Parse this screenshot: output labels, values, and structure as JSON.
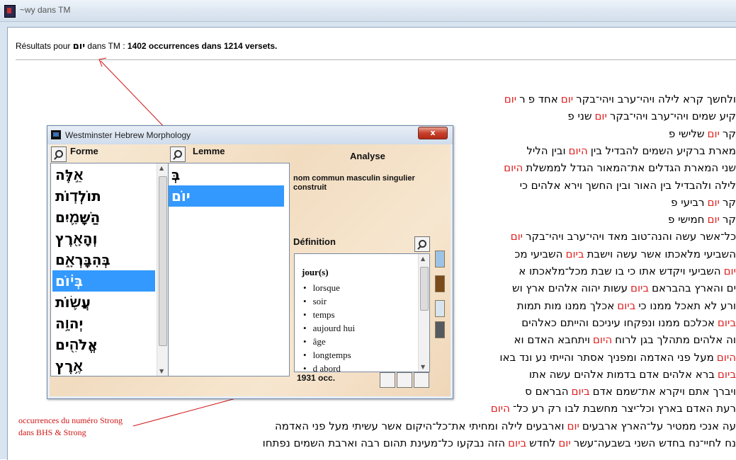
{
  "window": {
    "title": "~wy dans TM"
  },
  "results": {
    "prefix": "Résultats pour",
    "query": "יום",
    "middle": "dans TM :",
    "summary": "1402 occurrences dans 1214 versets."
  },
  "hebrew_lines": [
    [
      [
        "t",
        "ולחשך קרא לילה ויהי־ערב ויהי־בקר"
      ],
      [
        "h",
        "יום"
      ],
      [
        "t",
        "אחד פ"
      ],
      [
        "t",
        "ר"
      ],
      [
        "h",
        "יום"
      ]
    ],
    [
      [
        "t",
        "קיע שמים ויהי־ערב ויהי־בקר"
      ],
      [
        "h",
        "יום"
      ],
      [
        "t",
        "שני פ"
      ]
    ],
    [
      [
        "t",
        "קר"
      ],
      [
        "h",
        "יום"
      ],
      [
        "t",
        "שלישי פ"
      ]
    ],
    [
      [
        "t",
        "מארת ברקיע השמים להבדיל בין"
      ],
      [
        "h",
        "היום"
      ],
      [
        "t",
        "ובין הליל"
      ]
    ],
    [
      [
        "t",
        "שני המארת הגדלים את־המאור הגדל לממשלת"
      ],
      [
        "h",
        "היום"
      ]
    ],
    [
      [
        "t",
        "לילה ולהבדיל בין האור ובין החשך וירא אלהים כי"
      ]
    ],
    [
      [
        "t",
        "קר"
      ],
      [
        "h",
        "יום"
      ],
      [
        "t",
        "רביעי פ"
      ]
    ],
    [
      [
        "t",
        "קר"
      ],
      [
        "h",
        "יום"
      ],
      [
        "t",
        "חמישי פ"
      ]
    ],
    [
      [
        "t",
        "כל־אשר עשה והנה־טוב מאד ויהי־ערב ויהי־בקר"
      ],
      [
        "h",
        "יום"
      ]
    ],
    [
      [
        "t",
        "השביעי מלאכתו אשר עשה וישבת"
      ],
      [
        "h",
        "ביום"
      ],
      [
        "t",
        "השביעי מכ"
      ]
    ],
    [
      [
        "h",
        "יום"
      ],
      [
        "t",
        "השביעי ויקדש אתו כי בו שבת מכל־מלאכתו א"
      ]
    ],
    [
      [
        "t",
        "ים והארץ בהבראם"
      ],
      [
        "h",
        "ביום"
      ],
      [
        "t",
        "עשות יהוה אלהים ארץ וש"
      ]
    ],
    [
      [
        "t",
        "ורע לא תאכל ממנו כי"
      ],
      [
        "h",
        "ביום"
      ],
      [
        "t",
        "אכלך ממנו מות תמות"
      ]
    ],
    [
      [
        "h",
        "ביום"
      ],
      [
        "t",
        "אכלכם ממנו ונפקחו עיניכם והייתם כאלהים"
      ]
    ],
    [
      [
        "t",
        "וה אלהים מתהלך בגן לרוח"
      ],
      [
        "h",
        "היום"
      ],
      [
        "t",
        "ויתחבא האדם וא"
      ]
    ],
    [
      [
        "h",
        "היום"
      ],
      [
        "t",
        "מעל פני האדמה ומפניך אסתר והייתי נע ונד באו"
      ]
    ],
    [
      [
        "h",
        "ביום"
      ],
      [
        "t",
        "ברא אלהים אדם בדמות אלהים עשה אתו"
      ]
    ],
    [
      [
        "t",
        "ויברך אתם ויקרא את־שמם אדם"
      ],
      [
        "h",
        "ביום"
      ],
      [
        "t",
        "הבראם ס"
      ]
    ],
    [
      [
        "t",
        "רעת האדם בארץ וכל־יצר מחשבת לבו רק רע כל־"
      ],
      [
        "h",
        "היום"
      ]
    ],
    [
      [
        "t",
        "עה אנכי ממטיר על־הארץ ארבעים"
      ],
      [
        "h",
        "יום"
      ],
      [
        "t",
        "וארבעים לילה ומחיתי את־כל־היקום אשר עשיתי מעל פני האדמה"
      ]
    ],
    [
      [
        "t",
        "נח לחיי־נח בחדש השני בשבעה־עשר"
      ],
      [
        "h",
        "יום"
      ],
      [
        "t",
        "לחדש"
      ],
      [
        "h",
        "ביום"
      ],
      [
        "t",
        "הזה נבקעו כל־מעינת תהום רבה וארבת השמים נפתחו"
      ]
    ]
  ],
  "annotation": "occurrences du numéro Strong dans BHS & Strong",
  "dialog": {
    "title": "Westminster Hebrew Morphology",
    "close_label": "x",
    "forme_header": "Forme",
    "lemme_header": "Lemme",
    "analyse_header": "Analyse",
    "forme_items": [
      "אֵ֣לֶּה",
      "תוֹלְד֧וֹת",
      "הַשָּׁמַ֛יִם",
      "וְהָאָ֖רֶץ",
      "בְּהִבָּֽרְאָ֑ם",
      "בְּי֗וֹם",
      "עֲשׂ֛וֹת",
      "יְהוָ֥ה",
      "אֱלֹהִ֖ים",
      "אֶ֥רֶץ"
    ],
    "forme_selected": 5,
    "lemme_items": [
      "בְּ",
      "יוֹם"
    ],
    "lemme_selected": 1,
    "analyse_text": "nom commun masculin singulier construit",
    "definition_header": "Définition",
    "definition_title": "jour(s)",
    "definition_items": [
      "lorsque",
      "soir",
      "temps",
      "aujourd hui",
      "âge",
      "longtemps",
      "d abord"
    ],
    "occurrences": "1931 occ."
  },
  "colors": {
    "highlight": "#e02020",
    "selection": "#3399ff",
    "annotation": "#d01515"
  }
}
